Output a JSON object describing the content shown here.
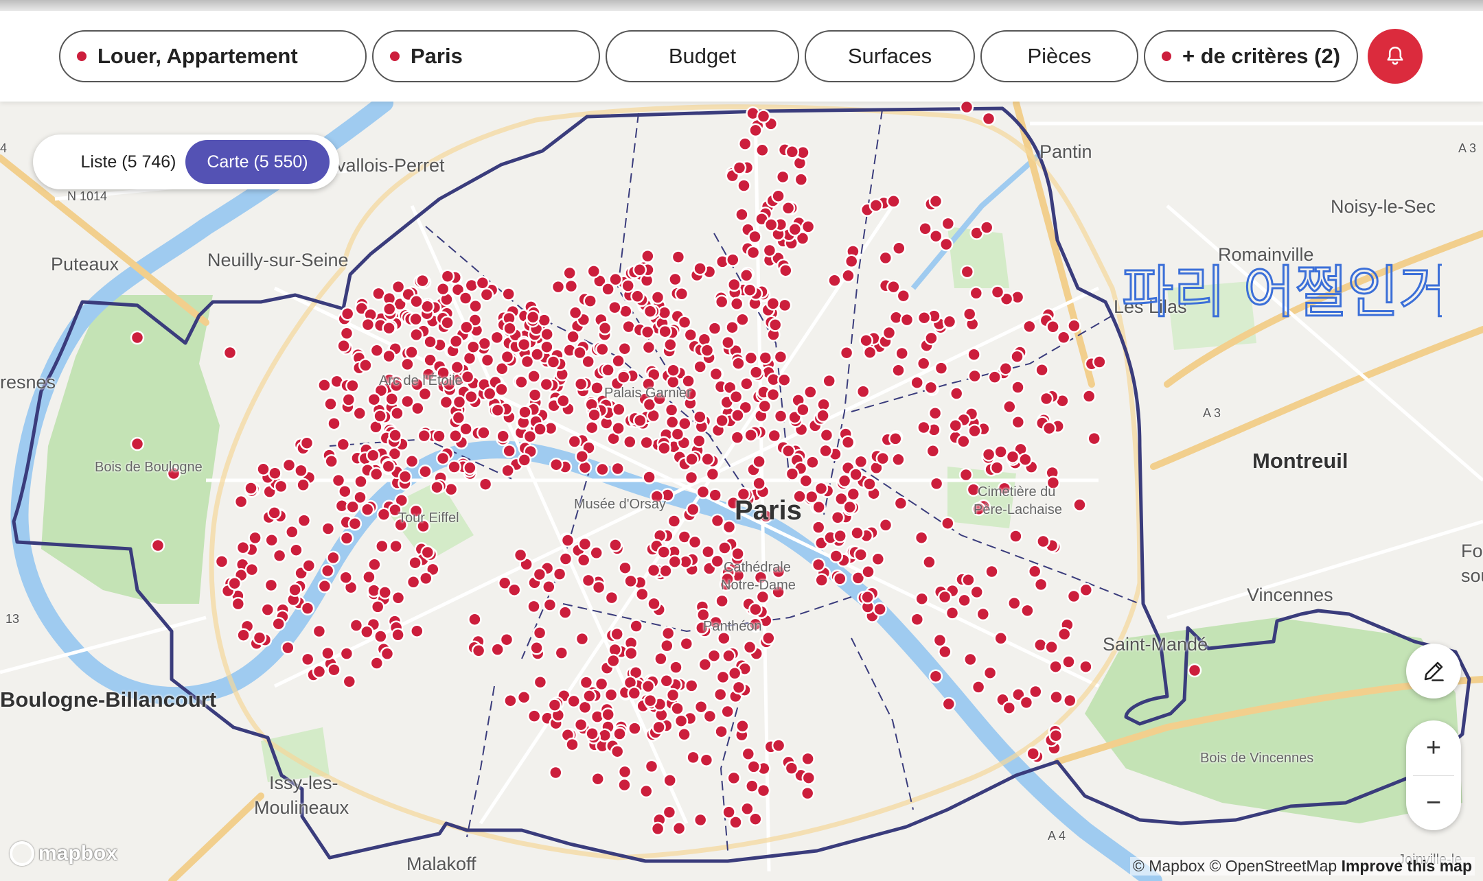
{
  "filters": {
    "transaction": "Louer, Appartement",
    "location": "Paris",
    "budget": "Budget",
    "surfaces": "Surfaces",
    "rooms": "Pièces",
    "more": "+ de critères (2)"
  },
  "view_toggle": {
    "list_label": "Liste (5 746)",
    "map_label": "Carte (5 550)"
  },
  "map": {
    "places": {
      "levallois": "vallois-Perret",
      "neuilly": "Neuilly-sur-Seine",
      "puteaux": "Puteaux",
      "suresnes": "resnes",
      "bois_boulogne": "Bois de Boulogne",
      "boulogne": "Boulogne-Billancourt",
      "issy_1": "Issy-les-",
      "issy_2": "Moulineaux",
      "malakoff": "Malakoff",
      "pantin": "Pantin",
      "noisy": "Noisy-le-Sec",
      "romainville": "Romainville",
      "lilas": "Les Lilas",
      "montreuil": "Montreuil",
      "fontenay_1": "Font",
      "fontenay_2": "sous",
      "vincennes": "Vincennes",
      "saint_mande": "Saint-Mandé",
      "bois_vincennes": "Bois de Vincennes",
      "joinville": "Joinville-le",
      "paris": "Paris",
      "arc": "Arc de l'Étoile",
      "palais": "Palais Garnier",
      "tour_eiffel": "Tour Eiffel",
      "musee": "Musée d'Orsay",
      "notre_dame_1": "Cathédrale",
      "notre_dame_2": "Notre-Dame",
      "pantheon": "Panthéon",
      "cimetiere_1": "Cimetière du",
      "cimetiere_2": "Père-Lachaise"
    },
    "roads": {
      "n1014": "N 1014",
      "a3_top": "A 3",
      "a3": "A 3",
      "a4": "A 4",
      "r13": "13",
      "r4": "4"
    },
    "annotation": "파리 어쩔인거",
    "attribution_mapbox": "© Mapbox",
    "attribution_osm": "© OpenStreetMap",
    "attribution_improve": "Improve this map",
    "mapbox_logo": "mapbox",
    "zoom_in": "+",
    "zoom_out": "−"
  },
  "colors": {
    "marker": "#cc1e3c",
    "boundary": "#3a3c7c",
    "toggle_active": "#5452b4",
    "alert": "#db2b3d",
    "park": "#c4e3b5",
    "water": "#9fcbf0"
  },
  "icons": {
    "alert": "bell-icon",
    "edit": "pencil-icon"
  }
}
